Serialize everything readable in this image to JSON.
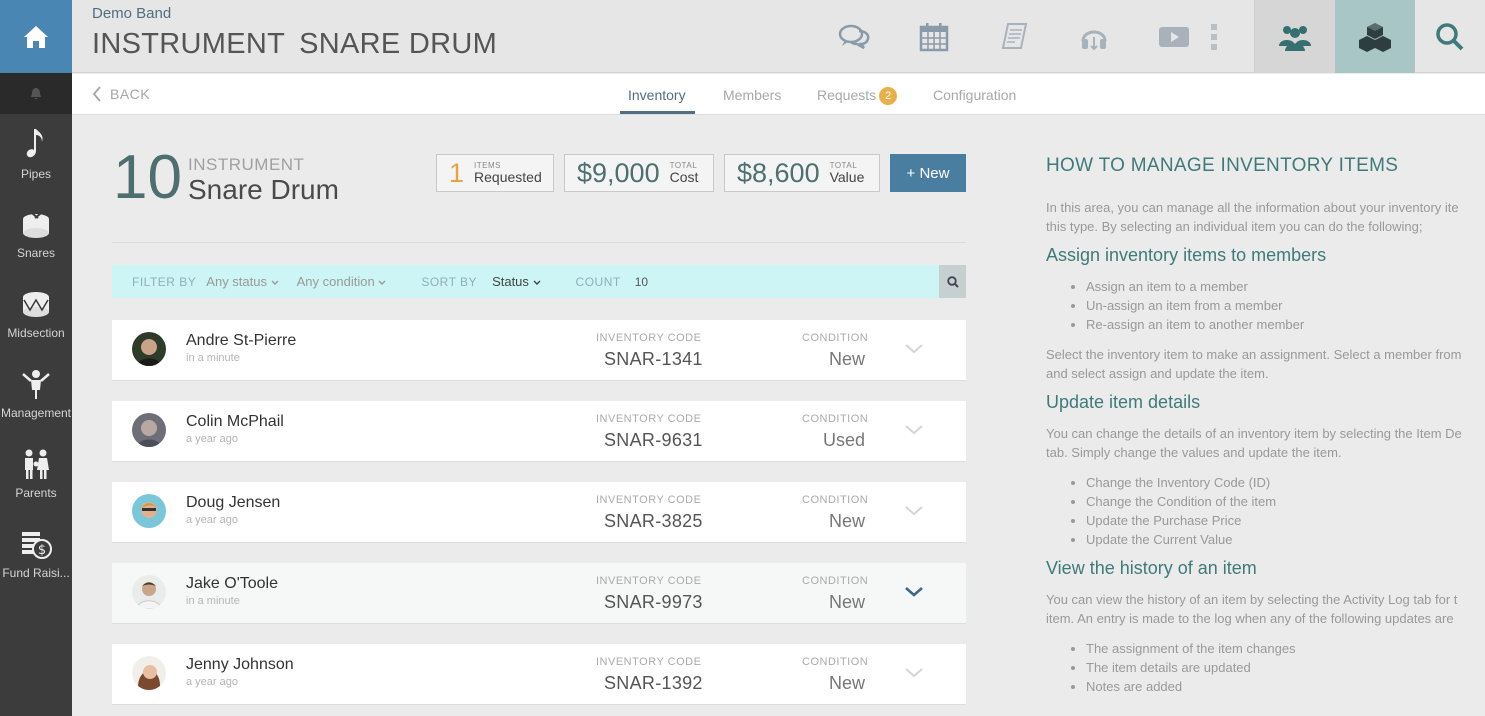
{
  "header": {
    "band_name": "Demo Band",
    "title_prefix": "INSTRUMENT",
    "title_name": "SNARE DRUM"
  },
  "sidebar": {
    "items": [
      {
        "label": "Pipes",
        "icon": "music-note-icon"
      },
      {
        "label": "Snares",
        "icon": "snare-drum-icon"
      },
      {
        "label": "Midsection",
        "icon": "bass-drum-icon"
      },
      {
        "label": "Management",
        "icon": "management-icon"
      },
      {
        "label": "Parents",
        "icon": "parents-icon"
      },
      {
        "label": "Fund Raisi...",
        "icon": "coins-icon"
      }
    ]
  },
  "tabs": {
    "back": "BACK",
    "items": [
      "Inventory",
      "Members",
      "Requests",
      "Configuration"
    ],
    "requests_badge": "2",
    "active": "Inventory"
  },
  "summary": {
    "count": "10",
    "label": "INSTRUMENT",
    "name": "Snare Drum",
    "requested": {
      "value": "1",
      "small": "ITEMS",
      "word": "Requested"
    },
    "cost": {
      "value": "$9,000",
      "small": "TOTAL",
      "word": "Cost"
    },
    "value": {
      "value": "$8,600",
      "small": "TOTAL",
      "word": "Value"
    },
    "new_button": "+ New"
  },
  "filter": {
    "filter_by": "FILTER BY",
    "status": "Any status",
    "condition": "Any condition",
    "sort_by": "SORT BY",
    "sort_value": "Status",
    "count_label": "COUNT",
    "count_value": "10"
  },
  "list": {
    "code_label": "INVENTORY CODE",
    "condition_label": "CONDITION",
    "rows": [
      {
        "name": "Andre St-Pierre",
        "time": "in a minute",
        "code": "SNAR-1341",
        "condition": "New"
      },
      {
        "name": "Colin McPhail",
        "time": "a year ago",
        "code": "SNAR-9631",
        "condition": "Used"
      },
      {
        "name": "Doug Jensen",
        "time": "a year ago",
        "code": "SNAR-3825",
        "condition": "New"
      },
      {
        "name": "Jake O'Toole",
        "time": "in a minute",
        "code": "SNAR-9973",
        "condition": "New"
      },
      {
        "name": "Jenny Johnson",
        "time": "a year ago",
        "code": "SNAR-1392",
        "condition": "New"
      }
    ]
  },
  "help": {
    "title": "HOW TO MANAGE INVENTORY ITEMS",
    "intro1": "In this area, you can manage all the information about your inventory ite",
    "intro2": "this type. By selecting an individual item you can do the following;",
    "s1_title": "Assign inventory items to members",
    "s1_items": [
      "Assign an item to a member",
      "Un-assign an item from a member",
      "Re-assign an item to another member"
    ],
    "s1_p1": "Select the inventory item to make an assignment. Select a member from",
    "s1_p2": "and select assign and update the item.",
    "s2_title": "Update item details",
    "s2_p1": "You can change the details of an inventory item by selecting the Item De",
    "s2_p2": "tab. Simply change the values and update the item.",
    "s2_items": [
      "Change the Inventory Code (ID)",
      "Change the Condition of the item",
      "Update the Purchase Price",
      "Update the Current Value"
    ],
    "s3_title": "View the history of an item",
    "s3_p1": "You can view the history of an item by selecting the Activity Log tab for t",
    "s3_p2": "item. An entry is made to the log when any of the following updates are",
    "s3_items": [
      "The assignment of the item changes",
      "The item details are updated",
      "Notes are added"
    ]
  },
  "colors": {
    "accent": "#4a7ea0",
    "sidebar": "#3c3c3c",
    "home": "#4a86b4",
    "teal": "#3f7a7a",
    "badge": "#e8b04b"
  }
}
